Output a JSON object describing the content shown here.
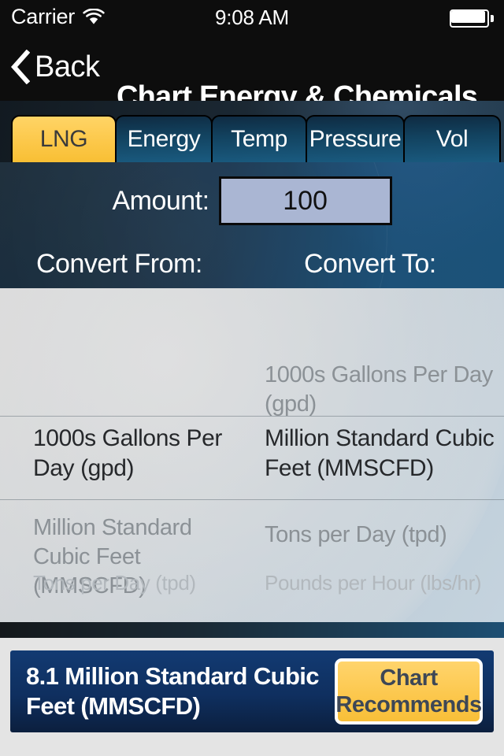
{
  "status_bar": {
    "carrier": "Carrier",
    "wifi_icon": "wifi-icon",
    "time": "9:08 AM",
    "battery_icon": "battery-full-icon"
  },
  "nav_bar": {
    "back_icon": "chevron-left-icon",
    "back_label": "Back",
    "title": "Chart Energy & Chemicals"
  },
  "tabs": {
    "items": [
      {
        "label": "LNG",
        "active": true
      },
      {
        "label": "Energy",
        "active": false
      },
      {
        "label": "Temp",
        "active": false
      },
      {
        "label": "Pressure",
        "active": false
      },
      {
        "label": "Vol",
        "active": false
      }
    ],
    "active_color": "#fcc84e",
    "inactive_color": "#12425f"
  },
  "form": {
    "amount_label": "Amount:",
    "amount_value": "100",
    "amount_placeholder": "100",
    "convert_from_label": "Convert From:",
    "convert_to_label": "Convert To:"
  },
  "picker_from": {
    "above_2": "",
    "above_1": "",
    "selected": "1000s Gallons Per Day (gpd)",
    "below_1": "Million Standard Cubic Feet (MMSCFD)",
    "below_2": "Tons per Day (tpd)"
  },
  "picker_to": {
    "above_1": "1000s Gallons Per Day (gpd)",
    "selected": "Million Standard Cubic Feet (MMSCFD)",
    "below_1": "Tons per Day (tpd)",
    "below_2": "Pounds per Hour (lbs/hr)"
  },
  "result": {
    "value_text": "8.1 Million Standard Cubic Feet (MMSCFD)",
    "button_line1": "Chart",
    "button_line2": "Recommends",
    "bar_color": "#0f2f5f",
    "button_color": "#fcc84e"
  }
}
